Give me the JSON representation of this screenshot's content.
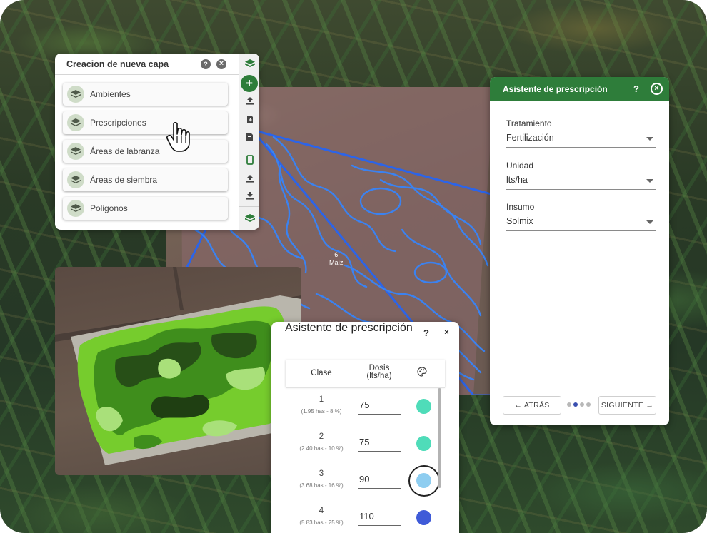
{
  "layer_panel": {
    "title": "Creacion de nueva capa",
    "help_label": "?",
    "close_label": "×",
    "items": [
      {
        "label": "Ambientes"
      },
      {
        "label": "Prescripciones"
      },
      {
        "label": "Áreas de labranza"
      },
      {
        "label": "Áreas de siembra"
      },
      {
        "label": "Poligonos"
      }
    ],
    "tools": [
      "layers-icon",
      "add-icon",
      "upload-icon",
      "export-icon",
      "file-icon",
      "phone-icon",
      "upload-icon",
      "download-icon",
      "layers-icon"
    ]
  },
  "map": {
    "field_number": "6",
    "field_crop": "Maíz"
  },
  "wizard_right": {
    "title": "Asistente de prescripción",
    "help": "?",
    "close": "×",
    "fields": [
      {
        "label": "Tratamiento",
        "value": "Fertilización"
      },
      {
        "label": "Unidad",
        "value": "lts/ha"
      },
      {
        "label": "Insumo",
        "value": "Solmix"
      }
    ],
    "back_label": "← ATRÁS",
    "next_label": "SIGUIENTE →",
    "step_current": 2,
    "step_total": 4
  },
  "wizard_bottom": {
    "title": "Asistente de prescripción",
    "help": "?",
    "close": "×",
    "col_clase": "Clase",
    "col_dosis_1": "Dosis",
    "col_dosis_2": "(lts/ha)",
    "rows": [
      {
        "clase": "1",
        "detail": "(1.95 has - 8 %)",
        "dosis": "75",
        "color": "#4fdcb9"
      },
      {
        "clase": "2",
        "detail": "(2.40 has - 10 %)",
        "dosis": "75",
        "color": "#4fdcb9"
      },
      {
        "clase": "3",
        "detail": "(3.68 has - 16 %)",
        "dosis": "90",
        "color": "#8ecdf0"
      },
      {
        "clase": "4",
        "detail": "(5.83 has - 25 %)",
        "dosis": "110",
        "color": "#3f5bd8"
      }
    ]
  },
  "colors": {
    "brand_green": "#2e7d3a",
    "zone_blue": "#3b82f0"
  }
}
